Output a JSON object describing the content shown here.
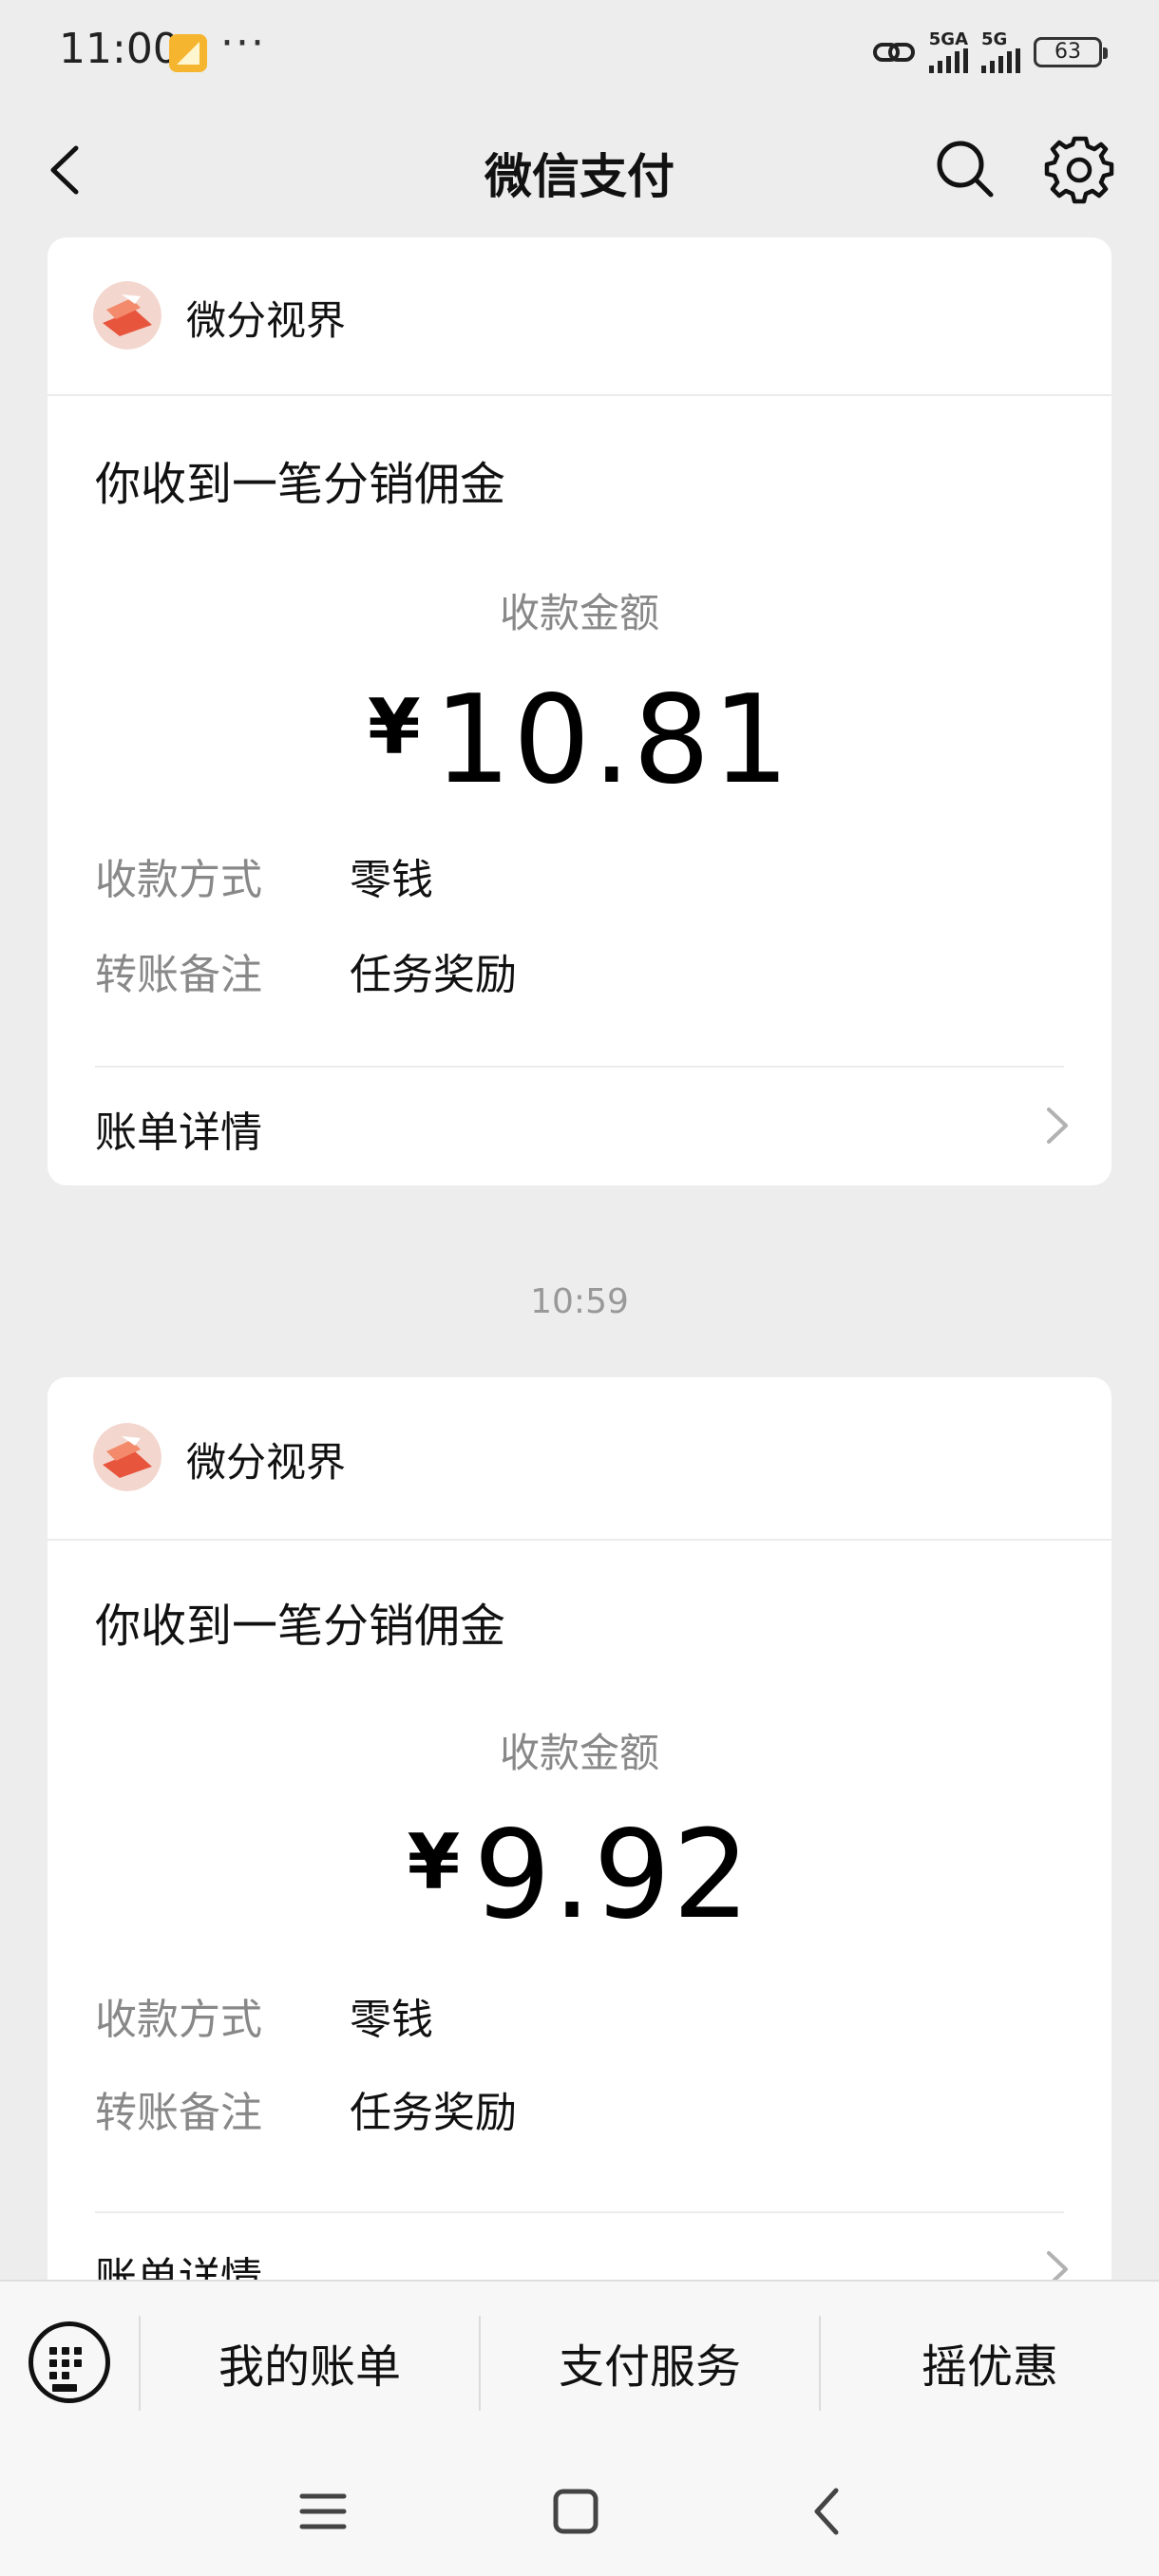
{
  "status_bar": {
    "time": "11:00",
    "dots": "···",
    "signal1_label": "5GA",
    "signal2_label": "5G",
    "battery": "63"
  },
  "nav": {
    "title": "微信支付"
  },
  "cards": [
    {
      "merchant": "微分视界",
      "title": "你收到一笔分销佣金",
      "amount_label": "收款金额",
      "currency": "¥",
      "amount": "10.81",
      "method_label": "收款方式",
      "method_value": "零钱",
      "note_label": "转账备注",
      "note_value": "任务奖励",
      "detail_label": "账单详情"
    },
    {
      "merchant": "微分视界",
      "title": "你收到一笔分销佣金",
      "amount_label": "收款金额",
      "currency": "¥",
      "amount": "9.92",
      "method_label": "收款方式",
      "method_value": "零钱",
      "note_label": "转账备注",
      "note_value": "任务奖励",
      "detail_label": "账单详情"
    }
  ],
  "time_separator": "10:59",
  "bottom_menu": {
    "items": [
      "我的账单",
      "支付服务",
      "摇优惠"
    ]
  },
  "icons": [
    "back-arrow-icon",
    "search-icon",
    "gear-icon",
    "keyboard-icon",
    "chevron-right-icon",
    "menu-lines-icon",
    "home-square-icon",
    "system-back-icon"
  ],
  "colors": {
    "background": "#ededed",
    "card": "#ffffff",
    "muted_text": "#888888",
    "accent_avatar": "#e8553d"
  }
}
